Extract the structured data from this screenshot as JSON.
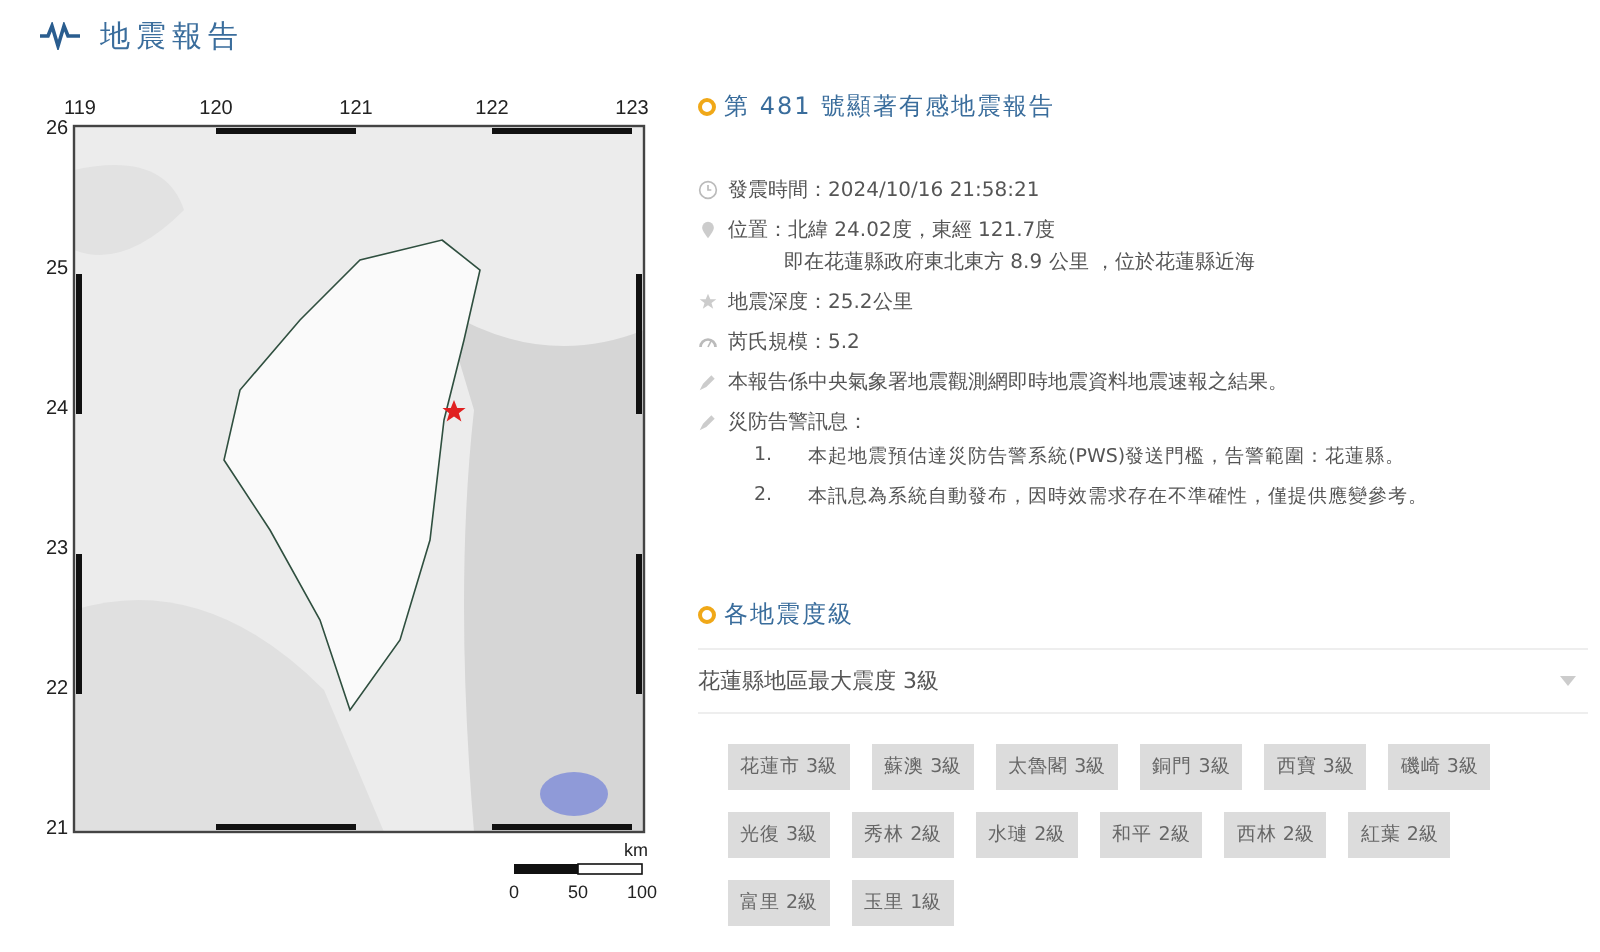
{
  "header": {
    "title": "地震報告"
  },
  "map": {
    "lon_labels": [
      "119",
      "120",
      "121",
      "122",
      "123"
    ],
    "lat_labels": [
      "26",
      "25",
      "24",
      "23",
      "22",
      "21"
    ],
    "scale": {
      "unit": "km",
      "labels": [
        "0",
        "50",
        "100"
      ]
    }
  },
  "report": {
    "title": "第 481 號顯著有感地震報告",
    "items": [
      {
        "kind": "time",
        "text": "發震時間：2024/10/16 21:58:21"
      },
      {
        "kind": "location",
        "text": "位置：北緯 24.02度，東經 121.7度",
        "sub": "即在花蓮縣政府東北東方 8.9 公里 ，位於花蓮縣近海"
      },
      {
        "kind": "depth",
        "text": "地震深度：25.2公里"
      },
      {
        "kind": "magnitude",
        "text": "芮氏規模：5.2"
      },
      {
        "kind": "note",
        "text": "本報告係中央氣象署地震觀測網即時地震資料地震速報之結果。"
      },
      {
        "kind": "note",
        "text": "災防告警訊息：",
        "list": [
          {
            "number": "1.",
            "text": "本起地震預估達災防告警系統(PWS)發送門檻，告警範圍：花蓮縣。"
          },
          {
            "number": "2.",
            "text": "本訊息為系統自動發布，因時效需求存在不準確性，僅提供應變參考。"
          }
        ]
      }
    ]
  },
  "intensity": {
    "title": "各地震度級",
    "dropdown": {
      "label": "花蓮縣地區最大震度 3級"
    },
    "tags": [
      "花蓮市 3級",
      "蘇澳 3級",
      "太魯閣 3級",
      "銅門 3級",
      "西寶 3級",
      "磯崎 3級",
      "光復 3級",
      "秀林 2級",
      "水璉 2級",
      "和平 2級",
      "西林 2級",
      "紅葉 2級",
      "富里 2級",
      "玉里 1級"
    ]
  }
}
